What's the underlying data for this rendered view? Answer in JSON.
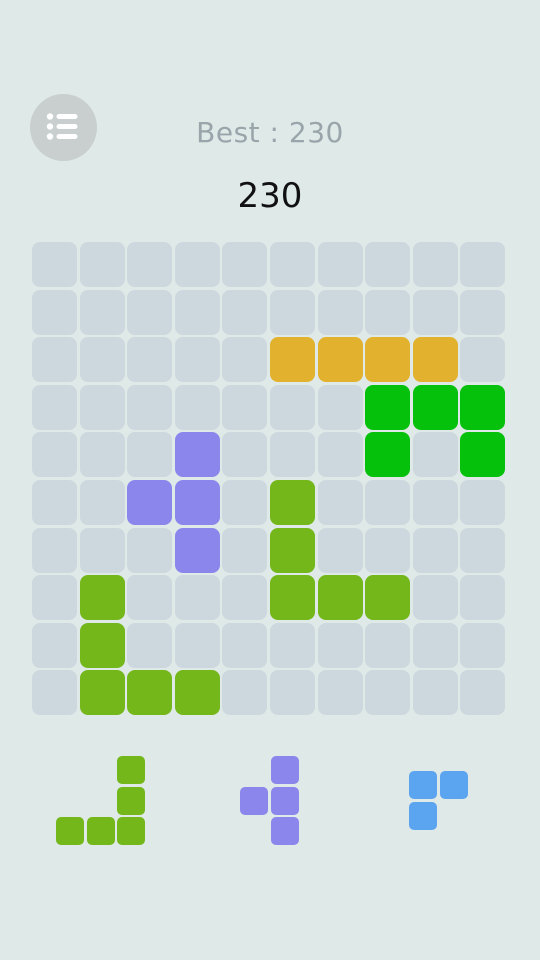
{
  "header": {
    "menu_icon": "list-icon",
    "best_text": "Best : 230",
    "score": "230"
  },
  "colors": {
    "background": "#dfe9e8",
    "empty": "#cdd7de",
    "yellow": "#e2b22f",
    "green": "#06c10c",
    "lime": "#74b71a",
    "purple": "#8a86ec",
    "blue": "#5ba4f0"
  },
  "board": {
    "size": 10,
    "rows": [
      [
        ".",
        ".",
        ".",
        ".",
        ".",
        ".",
        ".",
        ".",
        ".",
        "."
      ],
      [
        ".",
        ".",
        ".",
        ".",
        ".",
        ".",
        ".",
        ".",
        ".",
        "."
      ],
      [
        ".",
        ".",
        ".",
        ".",
        ".",
        "Y",
        "Y",
        "Y",
        "Y",
        "."
      ],
      [
        ".",
        ".",
        ".",
        ".",
        ".",
        ".",
        ".",
        "G",
        "G",
        "G"
      ],
      [
        ".",
        ".",
        ".",
        "P",
        ".",
        ".",
        ".",
        "G",
        ".",
        "G"
      ],
      [
        ".",
        ".",
        "P",
        "P",
        ".",
        "L",
        ".",
        ".",
        ".",
        "."
      ],
      [
        ".",
        ".",
        ".",
        "P",
        ".",
        "L",
        ".",
        ".",
        ".",
        "."
      ],
      [
        ".",
        "L",
        ".",
        ".",
        ".",
        "L",
        "L",
        "L",
        ".",
        "."
      ],
      [
        ".",
        "L",
        ".",
        ".",
        ".",
        ".",
        ".",
        ".",
        ".",
        "."
      ],
      [
        ".",
        "L",
        "L",
        "L",
        ".",
        ".",
        ".",
        ".",
        ".",
        "."
      ]
    ]
  },
  "tray": [
    {
      "color": "lime",
      "cells": [
        [
          0,
          2
        ],
        [
          1,
          2
        ],
        [
          2,
          0
        ],
        [
          2,
          1
        ],
        [
          2,
          2
        ]
      ]
    },
    {
      "color": "purple",
      "cells": [
        [
          0,
          1
        ],
        [
          1,
          0
        ],
        [
          1,
          1
        ],
        [
          2,
          1
        ]
      ]
    },
    {
      "color": "blue",
      "cells": [
        [
          0,
          0
        ],
        [
          0,
          1
        ],
        [
          1,
          0
        ]
      ]
    }
  ]
}
